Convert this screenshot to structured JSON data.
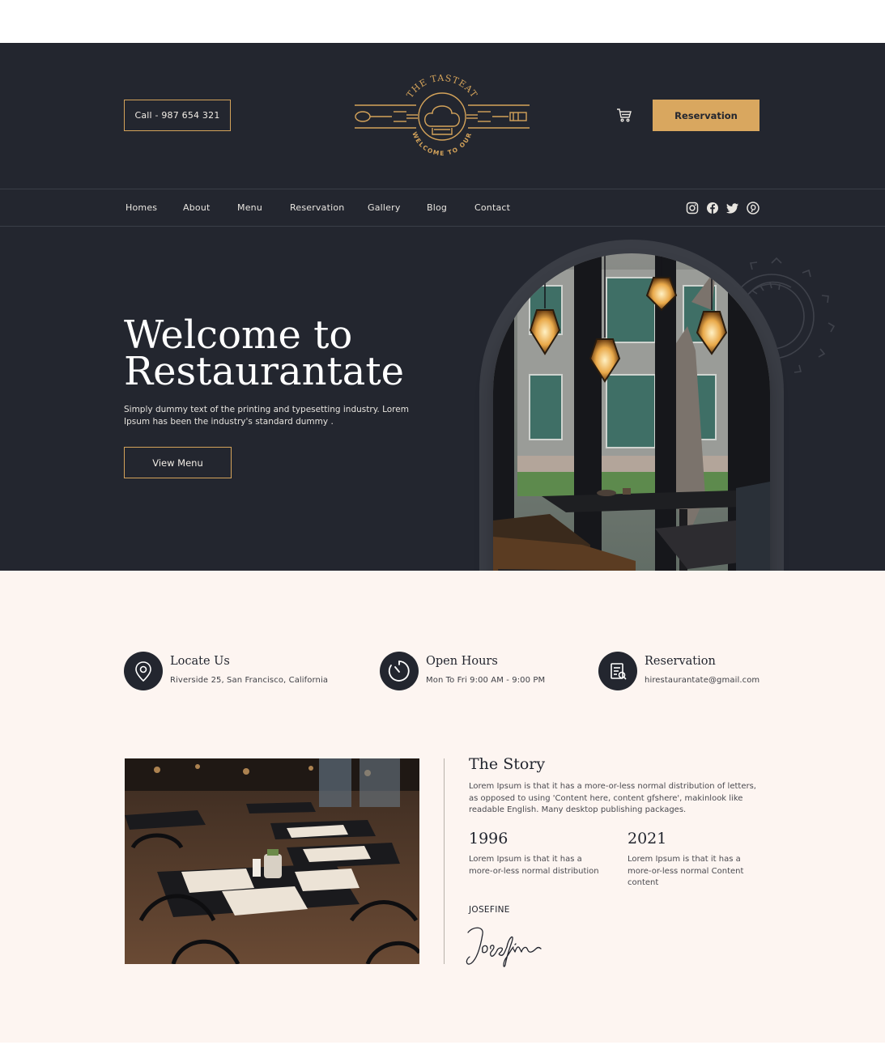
{
  "header": {
    "call_label": "Call - 987 654 321",
    "reservation_label": "Reservation",
    "logo": {
      "top_text": "THE TASTEAT",
      "bottom_text": "WELCOME TO OUR"
    }
  },
  "nav": {
    "items": [
      "Homes",
      "About",
      "Menu",
      "Reservation",
      "Gallery",
      "Blog",
      "Contact"
    ],
    "social_icons": [
      "instagram-icon",
      "facebook-icon",
      "twitter-icon",
      "pinterest-icon"
    ]
  },
  "hero": {
    "title_line1": "Welcome to",
    "title_line2": "Restaurantate",
    "description": "Simply dummy text of the printing and typesetting industry. Lorem Ipsum has been the industry's standard dummy .",
    "button_label": "View Menu"
  },
  "info": [
    {
      "icon": "location-pin-icon",
      "title": "Locate Us",
      "text": "Riverside 25, San Francisco, California"
    },
    {
      "icon": "clock-icon",
      "title": "Open Hours",
      "text": "Mon To Fri 9:00 AM - 9:00 PM"
    },
    {
      "icon": "reservation-list-icon",
      "title": "Reservation",
      "text": "hirestaurantate@gmail.com"
    }
  ],
  "story": {
    "title": "The Story",
    "text": "Lorem Ipsum is that it has a more-or-less normal distribution of letters, as opposed to using 'Content here, content gfshere', makinlook like readable English. Many desktop publishing packages.",
    "milestones": [
      {
        "year": "1996",
        "text": "Lorem Ipsum is that it has a more-or-less normal distribution"
      },
      {
        "year": "2021",
        "text": "Lorem Ipsum is that it has a more-or-less normal Content content"
      }
    ],
    "signature_name": "JOSEFINE",
    "signature_script": "Josefine"
  },
  "colors": {
    "dark": "#23262f",
    "gold": "#d9a75f",
    "cream": "#fdf5f1"
  }
}
